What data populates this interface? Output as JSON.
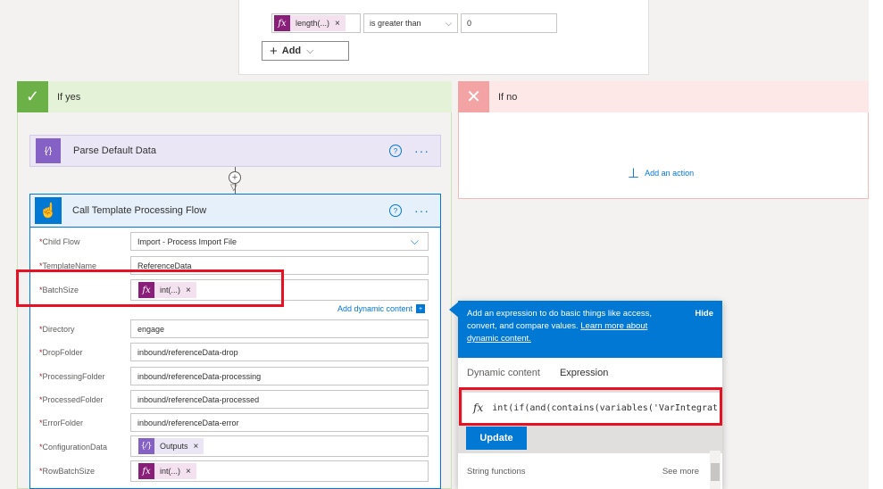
{
  "condition": {
    "left_token": "length(...)",
    "operator": "is greater than",
    "value": "0",
    "add_label": "Add"
  },
  "branches": {
    "yes_label": "If yes",
    "no_label": "If no",
    "add_action_label": "Add an action"
  },
  "parse_action": {
    "title": "Parse Default Data"
  },
  "call_action": {
    "title": "Call Template Processing Flow",
    "fields": [
      {
        "label": "Child Flow",
        "value": "Import - Process Import File"
      },
      {
        "label": "TemplateName",
        "value": "ReferenceData"
      },
      {
        "label": "BatchSize",
        "token": "int(...)"
      },
      {
        "label": "Directory",
        "value": "engage"
      },
      {
        "label": "DropFolder",
        "value": "inbound/referenceData-drop"
      },
      {
        "label": "ProcessingFolder",
        "value": "inbound/referenceData-processing"
      },
      {
        "label": "ProcessedFolder",
        "value": "inbound/referenceData-processed"
      },
      {
        "label": "ErrorFolder",
        "value": "inbound/referenceData-error"
      },
      {
        "label": "ConfigurationData",
        "token": "Outputs"
      },
      {
        "label": "RowBatchSize",
        "token": "int(...)"
      }
    ],
    "add_dynamic_label": "Add dynamic content"
  },
  "popup": {
    "description": "Add an expression to do basic things like access, convert, and compare values.",
    "learn_more": "Learn more about dynamic content.",
    "hide_label": "Hide",
    "tab_dynamic": "Dynamic content",
    "tab_expression": "Expression",
    "expression_value": "int(if(and(contains(variables('VarIntegrat",
    "update_label": "Update",
    "section_label": "String functions",
    "see_more": "See more"
  },
  "colors": {
    "accent": "#0078d4",
    "yes": "#6bb147",
    "no": "#f3a3a3",
    "expression_token": "#8a1f7a",
    "highlight": "#e81123"
  }
}
